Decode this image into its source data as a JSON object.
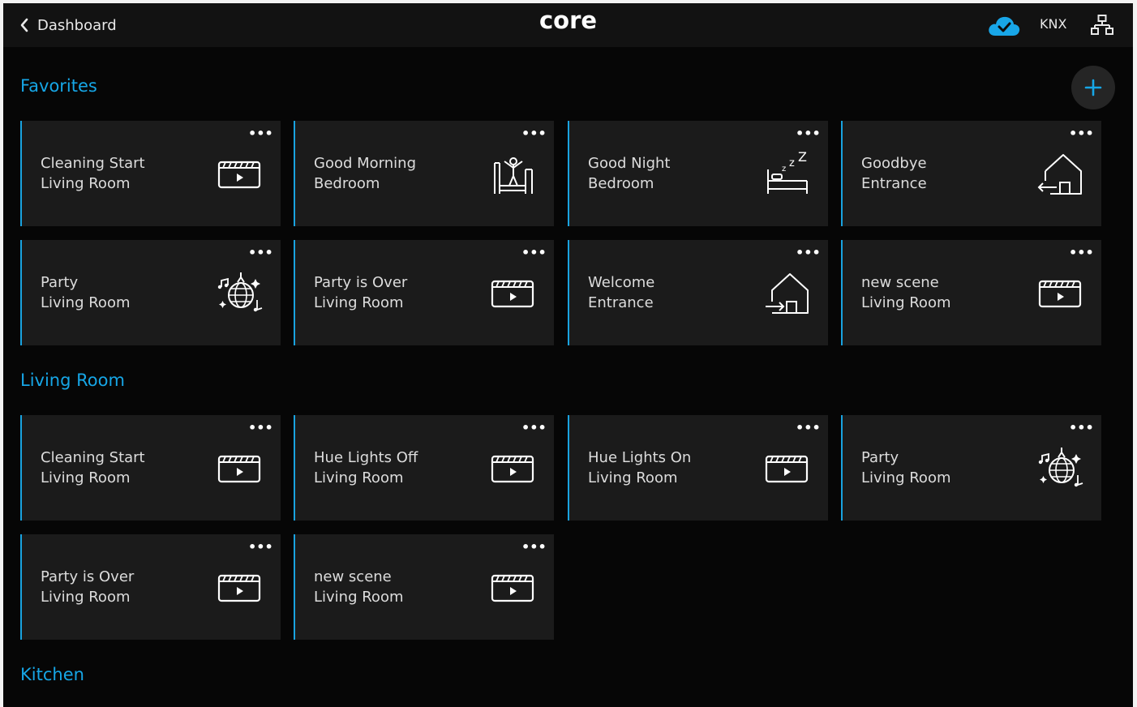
{
  "header": {
    "back_label": "Dashboard",
    "brand": "core",
    "protocol": "KNX",
    "cloud_status": "connected",
    "accent_color": "#16a6e6"
  },
  "sections": [
    {
      "title": "Favorites",
      "cards": [
        {
          "name": "Cleaning Start",
          "room": "Living Room",
          "icon": "clapperboard-icon"
        },
        {
          "name": "Good Morning",
          "room": "Bedroom",
          "icon": "wake-up-bed-icon"
        },
        {
          "name": "Good Night",
          "room": "Bedroom",
          "icon": "sleep-bed-icon"
        },
        {
          "name": "Goodbye",
          "room": "Entrance",
          "icon": "house-exit-icon"
        },
        {
          "name": "Party",
          "room": "Living Room",
          "icon": "disco-ball-icon"
        },
        {
          "name": "Party is Over",
          "room": "Living Room",
          "icon": "clapperboard-icon"
        },
        {
          "name": "Welcome",
          "room": "Entrance",
          "icon": "house-enter-icon"
        },
        {
          "name": "new scene",
          "room": "Living Room",
          "icon": "clapperboard-icon"
        }
      ]
    },
    {
      "title": "Living Room",
      "cards": [
        {
          "name": "Cleaning Start",
          "room": "Living Room",
          "icon": "clapperboard-icon"
        },
        {
          "name": "Hue Lights Off",
          "room": "Living Room",
          "icon": "clapperboard-icon"
        },
        {
          "name": "Hue Lights On",
          "room": "Living Room",
          "icon": "clapperboard-icon"
        },
        {
          "name": "Party",
          "room": "Living Room",
          "icon": "disco-ball-icon"
        },
        {
          "name": "Party is Over",
          "room": "Living Room",
          "icon": "clapperboard-icon"
        },
        {
          "name": "new scene",
          "room": "Living Room",
          "icon": "clapperboard-icon"
        }
      ]
    },
    {
      "title": "Kitchen",
      "cards": []
    }
  ],
  "more_label": "•••"
}
